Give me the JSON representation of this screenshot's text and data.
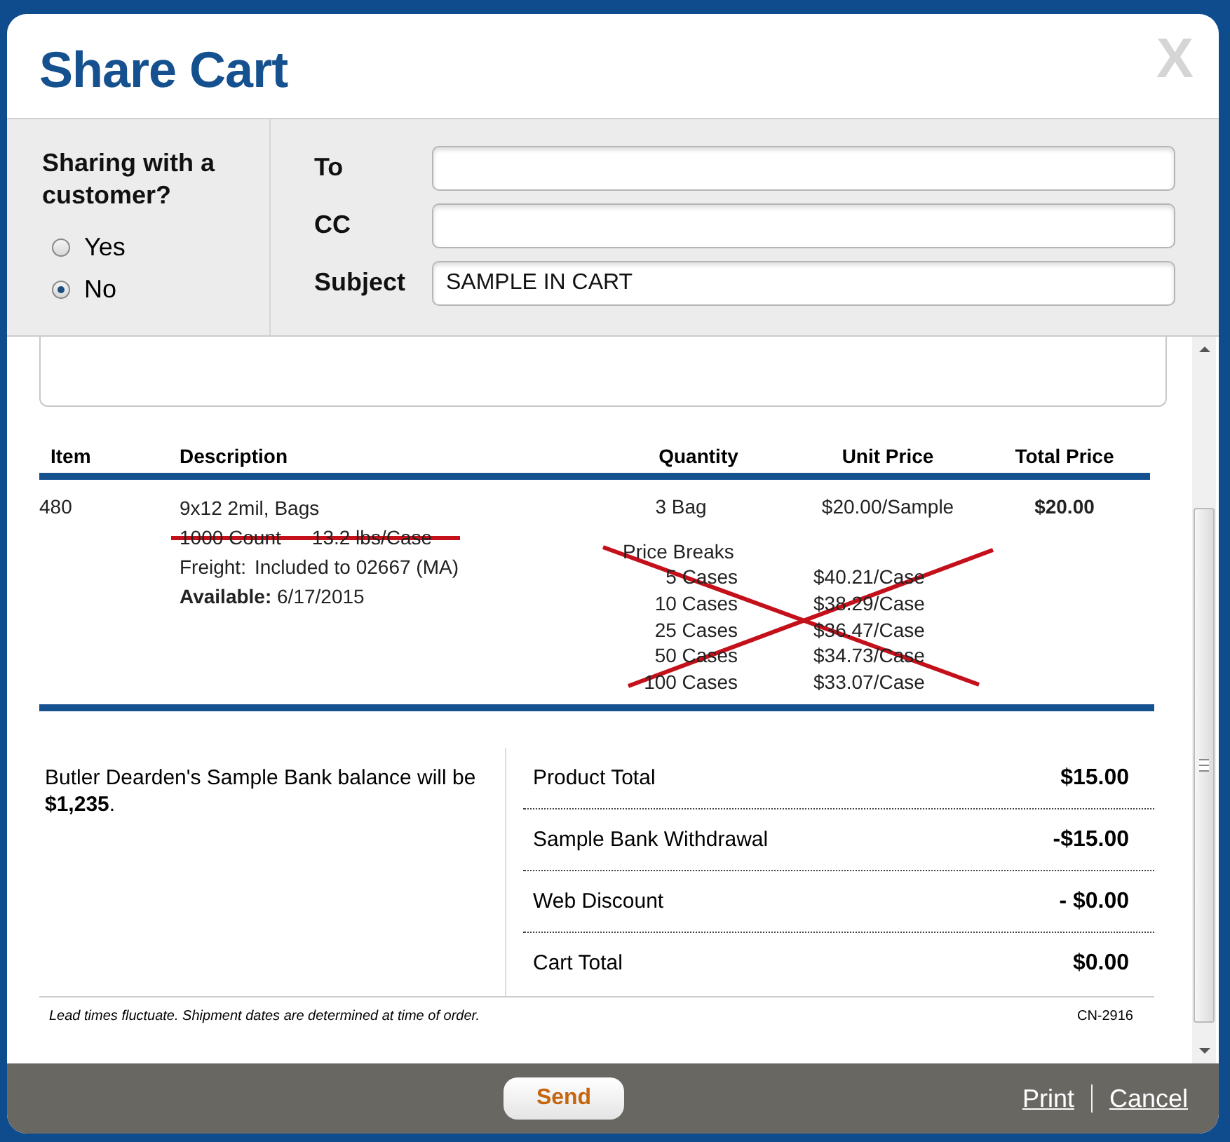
{
  "dialog": {
    "title": "Share Cart",
    "close": "X"
  },
  "sharing": {
    "question": "Sharing with a customer?",
    "options": [
      {
        "label": "Yes",
        "selected": false
      },
      {
        "label": "No",
        "selected": true
      }
    ]
  },
  "fields": [
    {
      "label": "To"
    },
    {
      "label": "CC"
    },
    {
      "label": "Subject",
      "value": "SAMPLE IN CART"
    }
  ],
  "table": {
    "columns": [
      "Item",
      "Description",
      "Quantity",
      "Unit Price",
      "Total Price"
    ],
    "rows": [
      {
        "item": "480",
        "description": [
          {
            "parts": [
              "9x12 2mil, Bags"
            ],
            "struck": false
          },
          {
            "parts": [
              "1000 Count",
              "13.2 lbs/Case"
            ],
            "struck": true
          }
        ],
        "freight_label": "Freight:",
        "freight": "Included to 02667 (MA)",
        "available": "**Available:** 6/17/2015",
        "quantity": "3 Bag",
        "unit_price": "$20.00/Sample",
        "total_price": "$20.00",
        "price_breaks": {
          "title": "Price Breaks",
          "crossed_out": true,
          "rows": [
            {
              "quantity": "5 Cases",
              "price": "$40.21/Case"
            },
            {
              "quantity": "10 Cases",
              "price": "$38.29/Case"
            },
            {
              "quantity": "25 Cases",
              "price": "$36.47/Case"
            },
            {
              "quantity": "50 Cases",
              "price": "$34.73/Case"
            },
            {
              "quantity": "100 Cases",
              "price": "$33.07/Case"
            }
          ]
        }
      }
    ]
  },
  "summary": {
    "note": "Butler Dearden's Sample Bank balance will be **$1,235**.",
    "lines": [
      {
        "label": "Product Total",
        "value": "$15.00"
      },
      {
        "label": "Sample Bank Withdrawal",
        "value": "-$15.00"
      },
      {
        "label": "Web Discount",
        "value": "- $0.00"
      },
      {
        "label": "Cart Total",
        "value": "$0.00"
      }
    ],
    "disclaimer": "Lead times fluctuate. Shipment dates are determined at time of order.",
    "code": "CN-2916"
  },
  "footer": {
    "send": "Send",
    "links": [
      "Print",
      "Cancel"
    ]
  }
}
